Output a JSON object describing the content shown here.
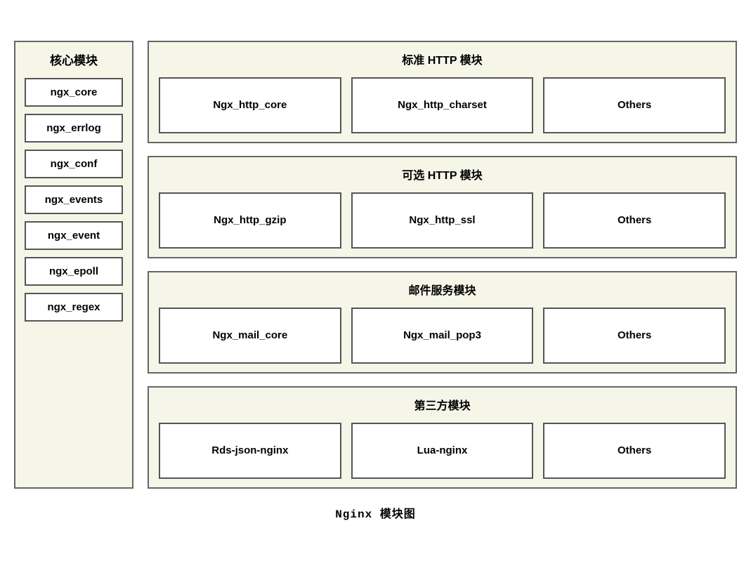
{
  "core_column": {
    "title": "核心模块",
    "modules": [
      {
        "label": "ngx_core"
      },
      {
        "label": "ngx_errlog"
      },
      {
        "label": "ngx_conf"
      },
      {
        "label": "ngx_events"
      },
      {
        "label": "ngx_event"
      },
      {
        "label": "ngx_epoll"
      },
      {
        "label": "ngx_regex"
      }
    ]
  },
  "module_groups": [
    {
      "title": "标准 HTTP 模块",
      "items": [
        "Ngx_http_core",
        "Ngx_http_charset",
        "Others"
      ]
    },
    {
      "title": "可选 HTTP 模块",
      "items": [
        "Ngx_http_gzip",
        "Ngx_http_ssl",
        "Others"
      ]
    },
    {
      "title": "邮件服务模块",
      "items": [
        "Ngx_mail_core",
        "Ngx_mail_pop3",
        "Others"
      ]
    },
    {
      "title": "第三方模块",
      "items": [
        "Rds-json-nginx",
        "Lua-nginx",
        "Others"
      ]
    }
  ],
  "caption": "Nginx 模块图"
}
